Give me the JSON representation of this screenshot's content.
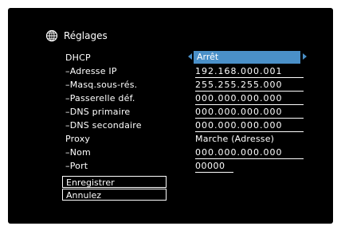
{
  "header": {
    "title": "Réglages",
    "icon": "globe-icon"
  },
  "rows": [
    {
      "label": "DHCP",
      "value": "Arrêt"
    },
    {
      "label": "–Adresse IP",
      "value": "192.168.000.001"
    },
    {
      "label": "–Masq.sous-rés.",
      "value": "255.255.255.000"
    },
    {
      "label": "–Passerelle déf.",
      "value": "000.000.000.000"
    },
    {
      "label": "–DNS primaire",
      "value": "000.000.000.000"
    },
    {
      "label": "–DNS secondaire",
      "value": "000.000.000.000"
    },
    {
      "label": "Proxy",
      "value": "Marche (Adresse)"
    },
    {
      "label": "–Nom",
      "value": "000.000.000.000"
    },
    {
      "label": "–Port",
      "value": "00000"
    }
  ],
  "buttons": {
    "save": "Enregistrer",
    "cancel": "Annulez"
  },
  "colors": {
    "background": "#000000",
    "selection": "#4a90c8",
    "text": "#ffffff"
  }
}
